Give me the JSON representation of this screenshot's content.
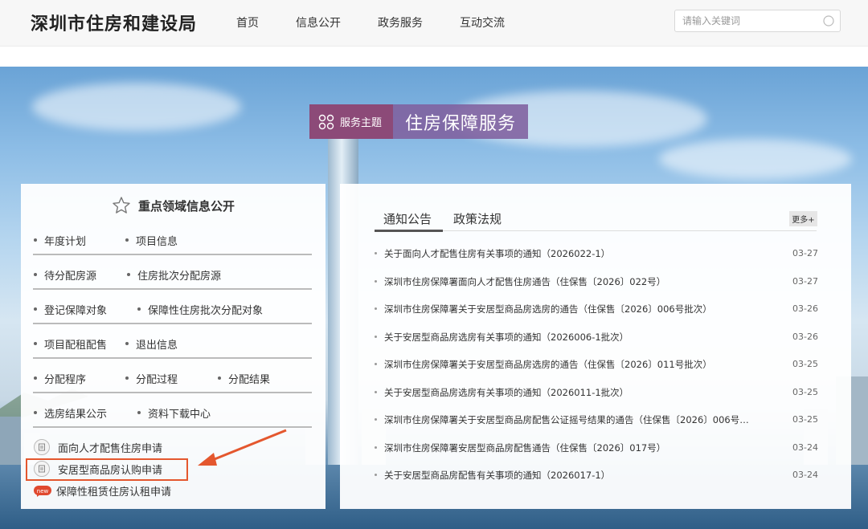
{
  "header": {
    "site_title": "深圳市住房和建设局",
    "nav": [
      "首页",
      "信息公开",
      "政务服务",
      "互动交流"
    ],
    "search": {
      "placeholder": "请输入关键词",
      "icon": "search-icon"
    }
  },
  "theme": {
    "badge_label": "服务主题",
    "title": "住房保障服务",
    "badge_color": "#8c4a78",
    "title_color": "#80609e"
  },
  "left_panel": {
    "title": "重点领域信息公开",
    "rows": [
      [
        "年度计划",
        "项目信息"
      ],
      [
        "待分配房源",
        "住房批次分配房源"
      ],
      [
        "登记保障对象",
        "保障性住房批次分配对象"
      ],
      [
        "项目配租配售",
        "退出信息"
      ],
      [
        "分配程序",
        "分配过程",
        "分配结果"
      ],
      [
        "选房结果公示",
        "资料下载中心"
      ]
    ],
    "applications": [
      {
        "label": "面向人才配售住房申请",
        "icon": "document-icon"
      },
      {
        "label": "安居型商品房认购申请",
        "icon": "document-icon",
        "highlighted": true
      },
      {
        "label": "保障性租赁住房认租申请",
        "icon": "new-badge-icon",
        "badge": "new"
      }
    ],
    "highlight_color": "#e4572e"
  },
  "right_panel": {
    "tabs": [
      "通知公告",
      "政策法规"
    ],
    "more_label": "更多+",
    "news": [
      {
        "title": "关于面向人才配售住房有关事项的通知（2026022-1）",
        "date": "03-27"
      },
      {
        "title": "深圳市住房保障署面向人才配售住房通告（住保售〔2026〕022号）",
        "date": "03-27"
      },
      {
        "title": "深圳市住房保障署关于安居型商品房选房的通告（住保售〔2026〕006号批次）",
        "date": "03-26"
      },
      {
        "title": "关于安居型商品房选房有关事项的通知（2026006-1批次）",
        "date": "03-26"
      },
      {
        "title": "深圳市住房保障署关于安居型商品房选房的通告（住保售〔2026〕011号批次）",
        "date": "03-25"
      },
      {
        "title": "关于安居型商品房选房有关事项的通知（2026011-1批次）",
        "date": "03-25"
      },
      {
        "title": "深圳市住房保障署关于安居型商品房配售公证摇号结果的通告（住保售〔2026〕006号…",
        "date": "03-25"
      },
      {
        "title": "深圳市住房保障署安居型商品房配售通告（住保售〔2026〕017号）",
        "date": "03-24"
      },
      {
        "title": "关于安居型商品房配售有关事项的通知（2026017-1）",
        "date": "03-24"
      }
    ]
  }
}
